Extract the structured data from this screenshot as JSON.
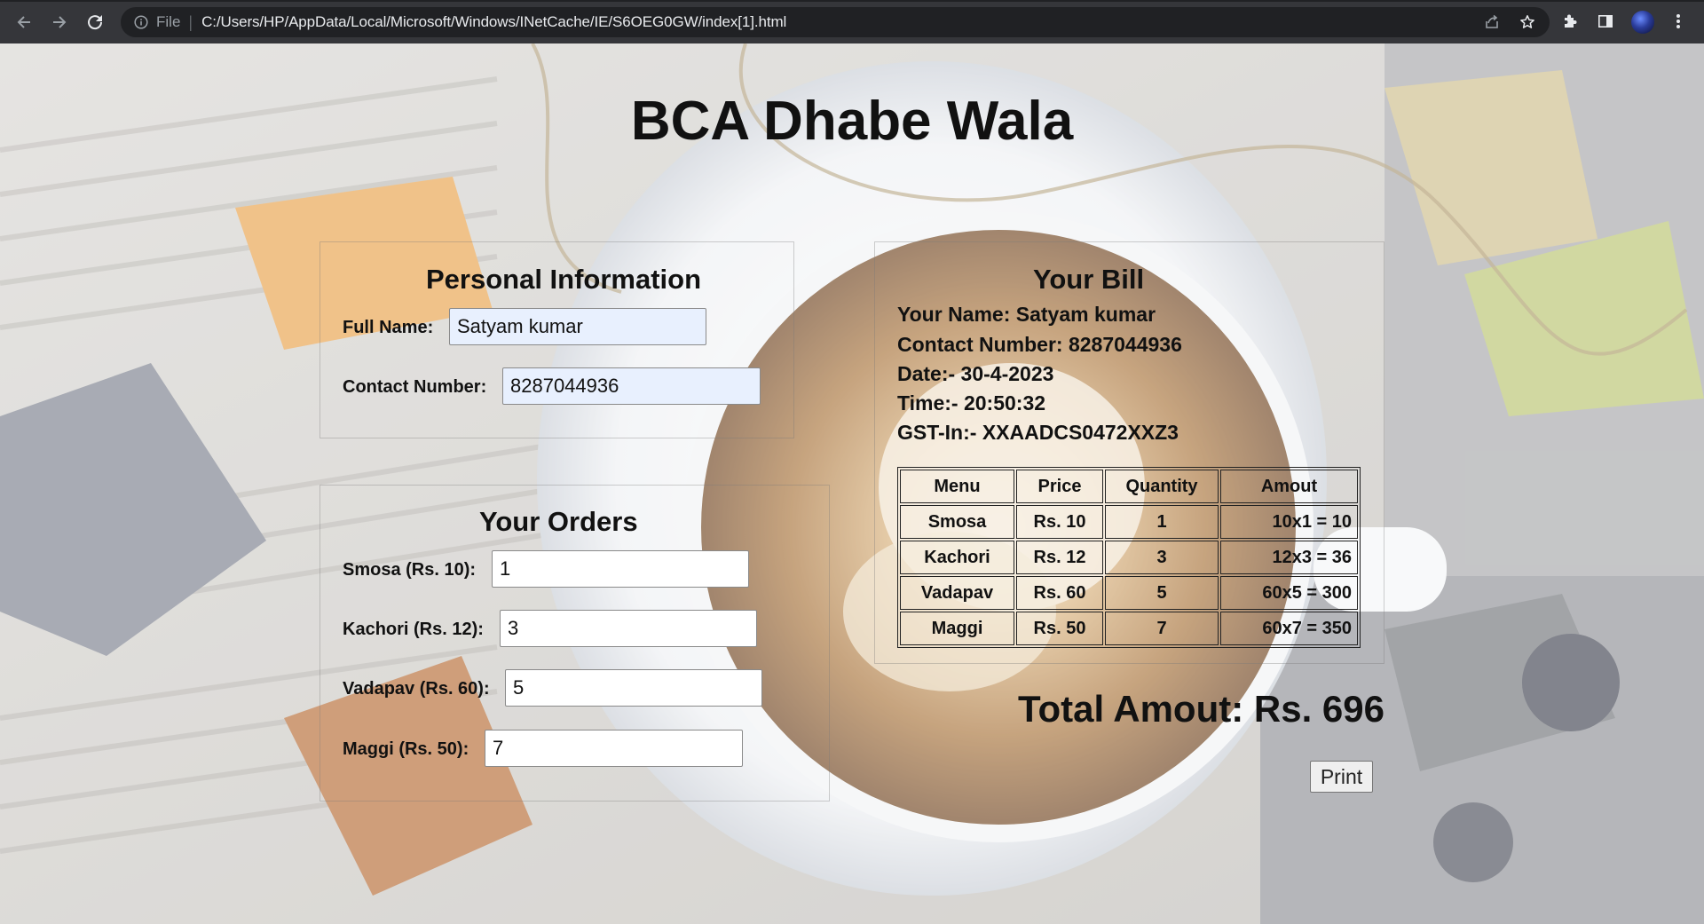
{
  "browser": {
    "scheme_label": "File",
    "url": "C:/Users/HP/AppData/Local/Microsoft/Windows/INetCache/IE/S6OEG0GW/index[1].html",
    "icons": [
      "back-arrow-icon",
      "forward-arrow-icon",
      "reload-icon",
      "info-icon",
      "share-icon",
      "bookmark-star-icon",
      "extensions-puzzle-icon",
      "side-panel-icon",
      "profile-avatar",
      "kebab-menu-icon"
    ]
  },
  "page": {
    "title": "BCA Dhabe Wala",
    "background": "coffee cup on newspaper with sweets"
  },
  "personal": {
    "heading": "Personal Information",
    "name_label": "Full Name:",
    "name_value": "Satyam kumar",
    "contact_label": "Contact Number:",
    "contact_value": "8287044936"
  },
  "orders": {
    "heading": "Your Orders",
    "items": [
      {
        "label": "Smosa (Rs. 10):",
        "value": "1"
      },
      {
        "label": "Kachori (Rs. 12):",
        "value": "3"
      },
      {
        "label": "Vadapav (Rs. 60):",
        "value": "5"
      },
      {
        "label": "Maggi (Rs. 50):",
        "value": "7"
      }
    ]
  },
  "bill": {
    "heading": "Your Bill",
    "name_line": "Your Name: Satyam kumar",
    "contact_line": "Contact Number: 8287044936",
    "date_line": "Date:- 30-4-2023",
    "time_line": "Time:- 20:50:32",
    "gst_line": "GST-In:- XXAADCS0472XXZ3",
    "columns": [
      "Menu",
      "Price",
      "Quantity",
      "Amout"
    ],
    "rows": [
      [
        "Smosa",
        "Rs. 10",
        "1",
        "10x1 = 10"
      ],
      [
        "Kachori",
        "Rs. 12",
        "3",
        "12x3 = 36"
      ],
      [
        "Vadapav",
        "Rs. 60",
        "5",
        "60x5 = 300"
      ],
      [
        "Maggi",
        "Rs. 50",
        "7",
        "60x7 = 350"
      ]
    ],
    "total": "Total Amout: Rs. 696",
    "print_label": "Print"
  },
  "colors": {
    "chrome_bar": "#35363a",
    "omnibox": "#202124",
    "autofill": "#e8f0fe",
    "text": "#111111"
  }
}
